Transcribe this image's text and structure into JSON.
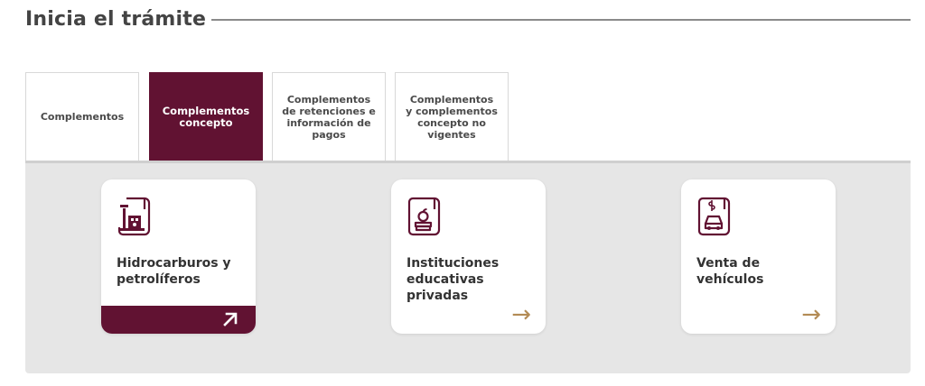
{
  "page": {
    "title": "Inicia el trámite"
  },
  "tabs": [
    {
      "label": "Complementos",
      "active": false
    },
    {
      "label": "Complementos\nconcepto",
      "active": true
    },
    {
      "label": "Complementos\nde retenciones e\ninformación de\npagos",
      "active": false
    },
    {
      "label": "Complementos\ny complementos\nconcepto no\nvigentes",
      "active": false
    }
  ],
  "cards": [
    {
      "label": "Hidrocarburos y\npetrolíferos",
      "icon": "oil-refinery-document-icon",
      "action": "external-link-arrow-icon",
      "highlighted": true
    },
    {
      "label": "Instituciones\neducativas\nprivadas",
      "icon": "apple-books-document-icon",
      "action": "right-arrow-icon",
      "highlighted": false
    },
    {
      "label": "Venta de\nvehículos",
      "icon": "car-dollar-document-icon",
      "action": "right-arrow-icon",
      "highlighted": false
    }
  ],
  "colors": {
    "brand": "#611232",
    "accent": "#b38b55",
    "panel": "#e6e6e6"
  }
}
